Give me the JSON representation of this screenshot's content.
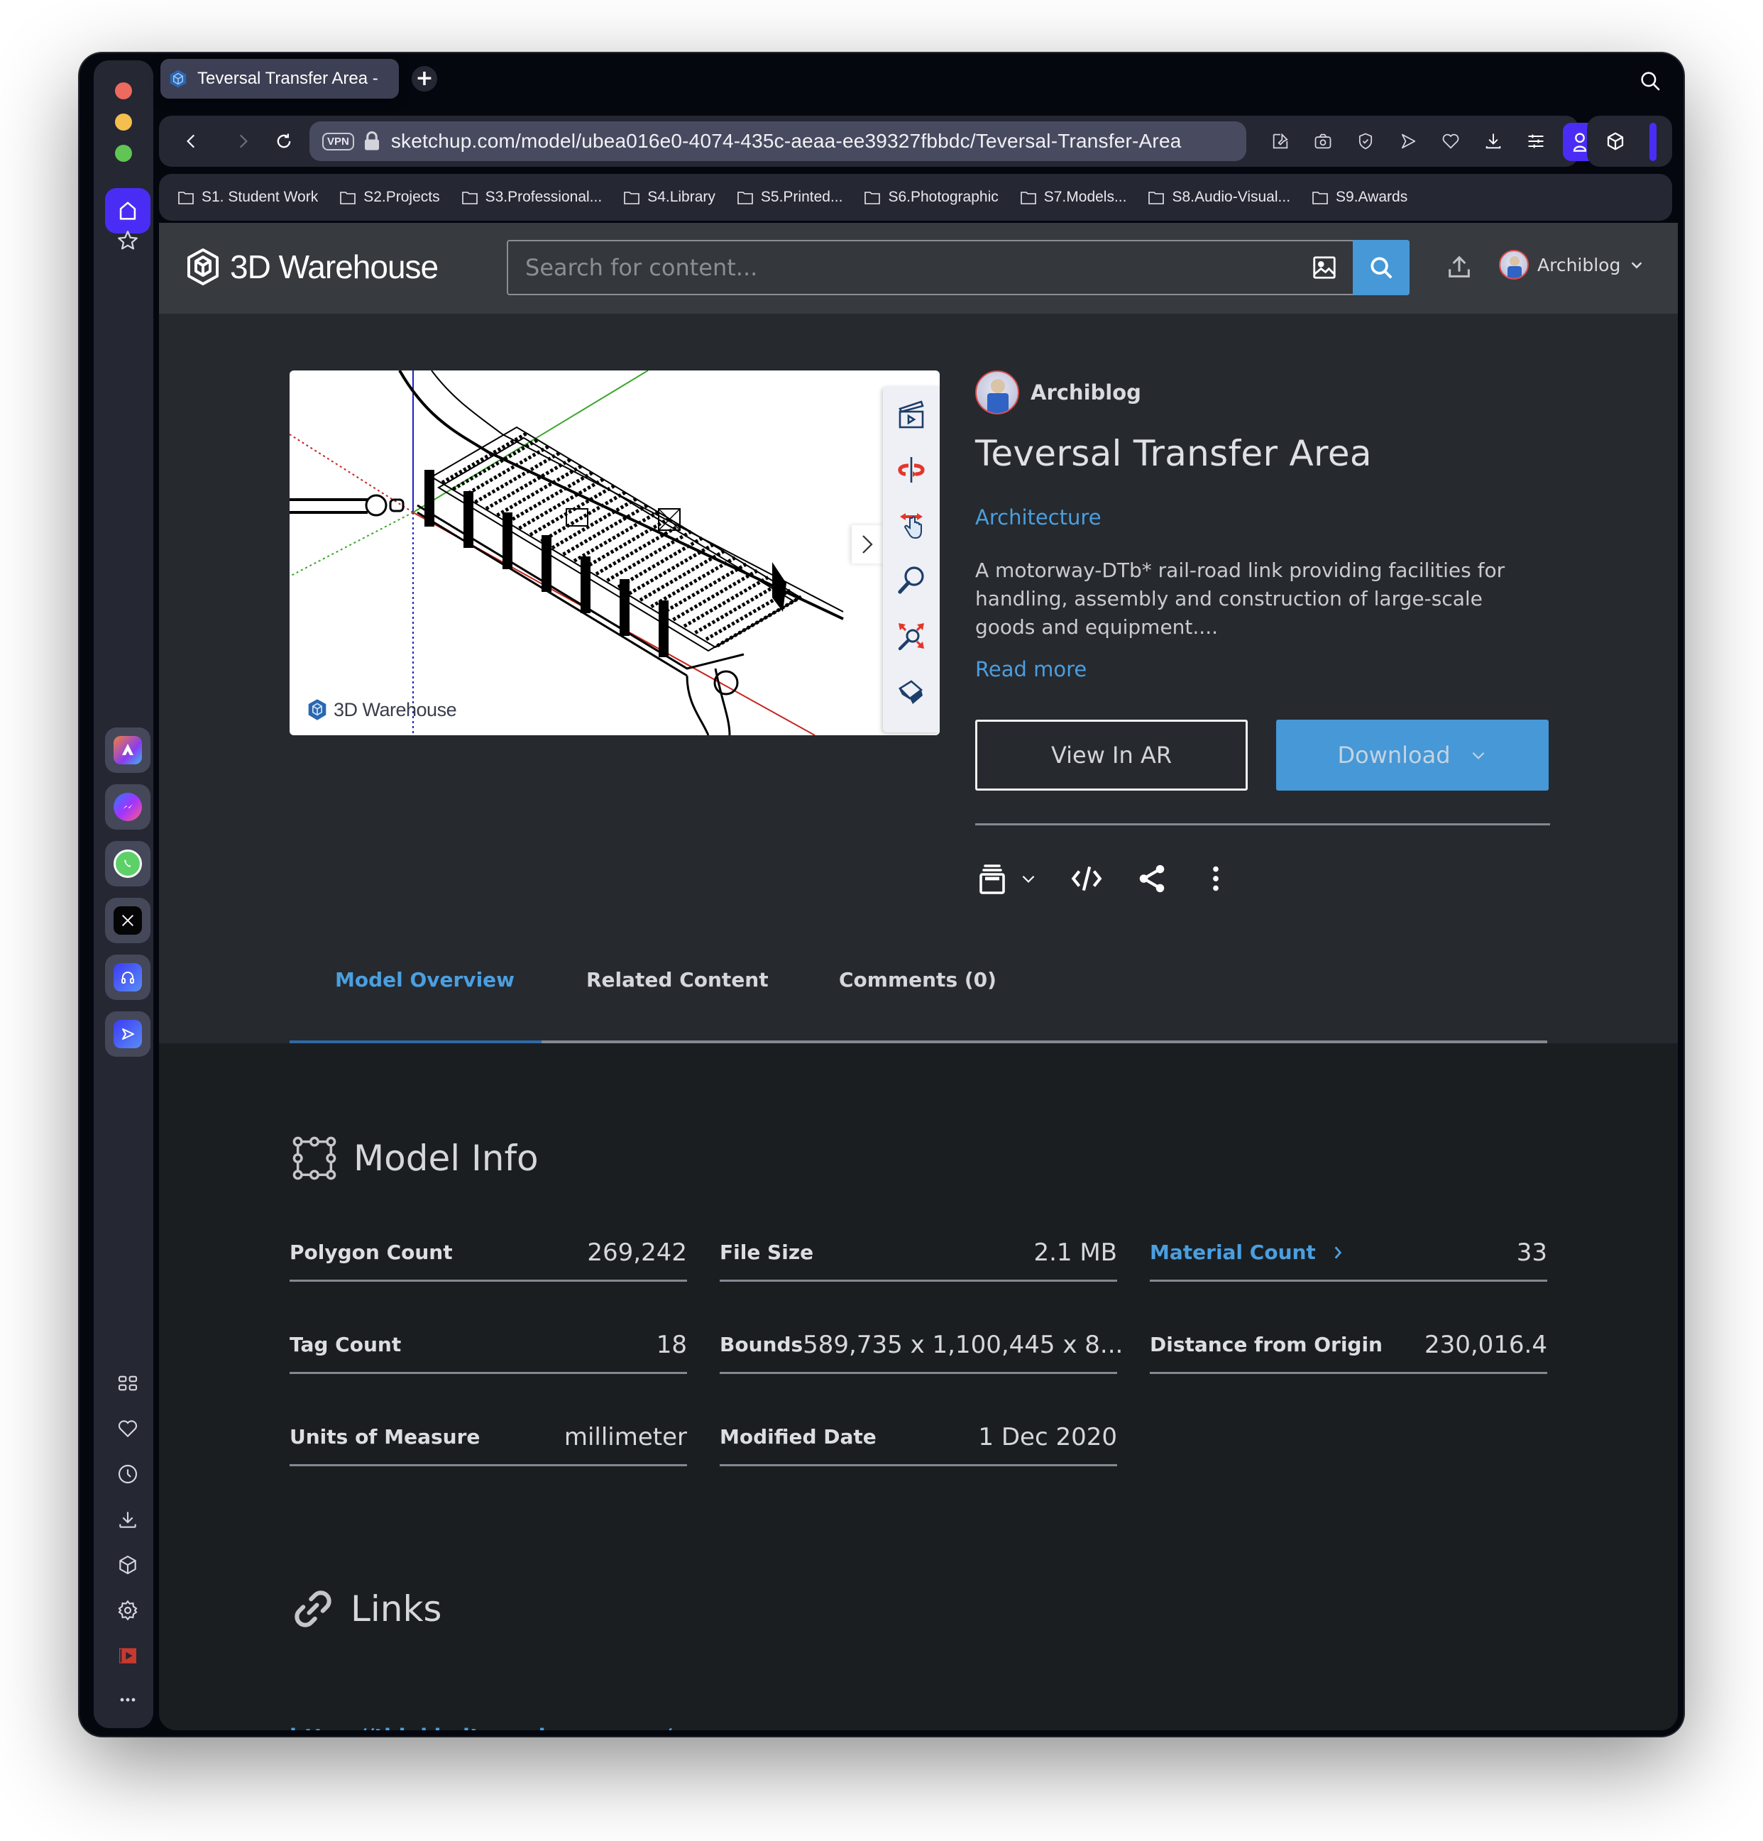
{
  "browser": {
    "tab": {
      "title": "Teversal Transfer Area -"
    },
    "url": "sketchup.com/model/ubea016e0-4074-435c-aeaa-ee39327fbbdc/Teversal-Transfer-Area",
    "vpn_label": "VPN",
    "bookmarks": [
      "S1. Student Work",
      "S2.Projects",
      "S3.Professional...",
      "S4.Library",
      "S5.Printed...",
      "S6.Photographic",
      "S7.Models...",
      "S8.Audio-Visual...",
      "S9.Awards"
    ],
    "accent_color": "#4a2df5"
  },
  "site": {
    "logo_text": "3D Warehouse",
    "search_placeholder": "Search for content...",
    "user_name": "Archiblog",
    "accent_color": "#4698d6"
  },
  "model": {
    "author": "Archiblog",
    "title": "Teversal Transfer Area",
    "category": "Architecture",
    "description": "A motorway-DTb* rail-road link providing facilities for handling, assembly and construction of large-scale goods and equipment....",
    "read_more": "Read more",
    "view_ar_label": "View In AR",
    "download_label": "Download",
    "viewer_watermark": "3D Warehouse"
  },
  "tabs": [
    {
      "label": "Model Overview",
      "active": true
    },
    {
      "label": "Related Content",
      "active": false
    },
    {
      "label": "Comments (0)",
      "active": false
    }
  ],
  "model_info": {
    "title": "Model Info",
    "rows": [
      {
        "label": "Polygon Count",
        "value": "269,242"
      },
      {
        "label": "File Size",
        "value": "2.1 MB"
      },
      {
        "label": "Material Count",
        "value": "33",
        "link": true
      },
      {
        "label": "Tag Count",
        "value": "18"
      },
      {
        "label": "Bounds",
        "value": "589,735 x 1,100,445 x 8..."
      },
      {
        "label": "Distance from Origin",
        "value": "230,016.4"
      },
      {
        "label": "Units of Measure",
        "value": "millimeter"
      },
      {
        "label": "Modified Date",
        "value": "1 Dec 2020"
      }
    ]
  },
  "links": {
    "title": "Links",
    "items": [
      "https://thinkbelt.wordpress.com/"
    ]
  }
}
